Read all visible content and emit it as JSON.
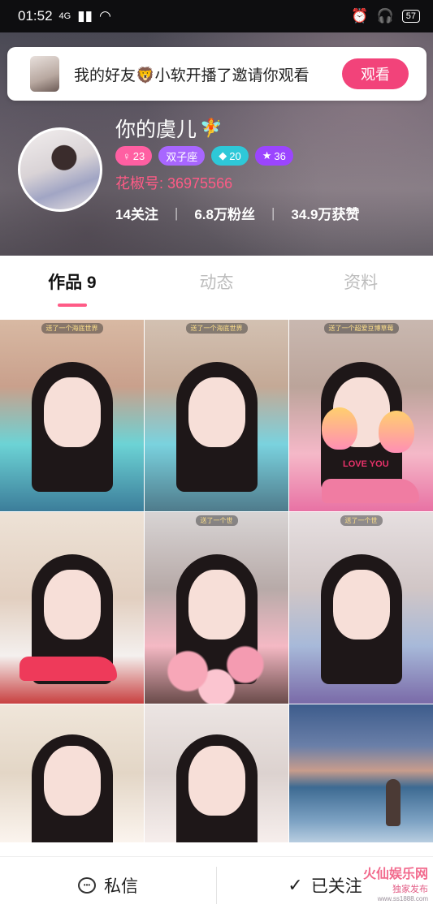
{
  "status_bar": {
    "time": "01:52",
    "network": "4G",
    "battery": "57"
  },
  "notification": {
    "text": "我的好友🦁小软开播了邀请你观看",
    "button": "观看"
  },
  "profile": {
    "name": "你的虞儿",
    "name_emoji": "🧚",
    "badges": [
      {
        "icon": "♀",
        "label": "23"
      },
      {
        "icon": "",
        "label": "双子座"
      },
      {
        "icon": "◆",
        "label": "20"
      },
      {
        "icon": "★",
        "label": "36"
      }
    ],
    "huajiao_id": "花椒号: 36975566",
    "following": "14关注",
    "fans": "6.8万粉丝",
    "likes": "34.9万获赞"
  },
  "tabs": [
    {
      "label": "作品 9",
      "active": true
    },
    {
      "label": "动态",
      "active": false
    },
    {
      "label": "资料",
      "active": false
    }
  ],
  "grid": {
    "items": [
      {
        "banner": "送了一个海底世界"
      },
      {
        "banner": "送了一个海底世界"
      },
      {
        "banner": "送了一个超爱豆博草莓"
      },
      {
        "banner": ""
      },
      {
        "banner": "送了一个世"
      },
      {
        "banner": "送了一个世"
      },
      {
        "banner": ""
      },
      {
        "banner": ""
      },
      {
        "banner": ""
      }
    ]
  },
  "overlay_text": {
    "love_you": "LOVE YOU"
  },
  "bottom_bar": {
    "message": "私信",
    "followed": "已关注"
  },
  "watermark": {
    "main": "火仙娱乐网",
    "sub": "独家发布",
    "url": "www.ss1888.com"
  },
  "colors": {
    "accent": "#ff5b86",
    "button": "#f2437a",
    "status_bar": "#0e0e10"
  }
}
